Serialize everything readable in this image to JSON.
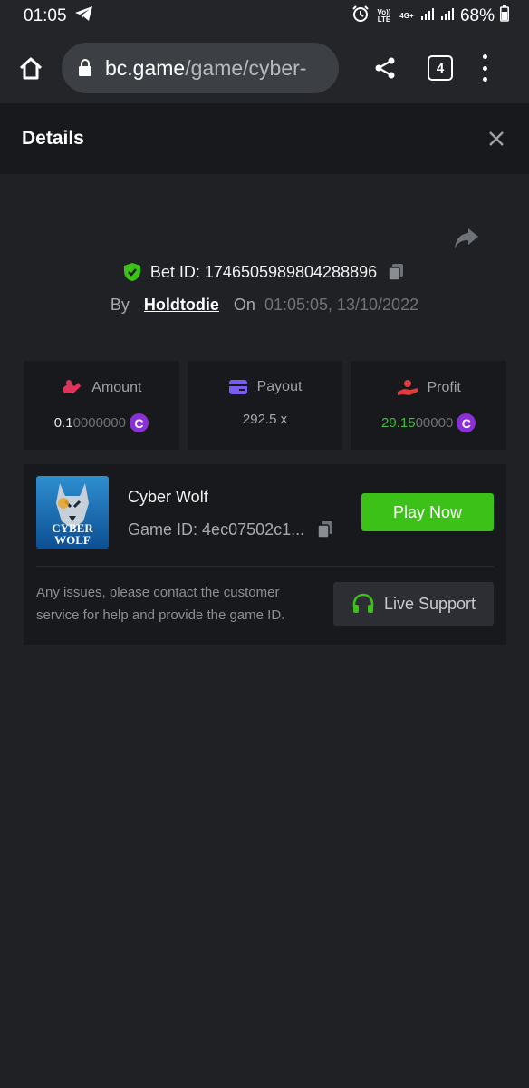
{
  "status_bar": {
    "time": "01:05",
    "volte_label": "Vo)) LTE",
    "network_label": "4G+",
    "battery": "68%"
  },
  "browser": {
    "url_host": "bc.game",
    "url_path": "/game/cyber-",
    "tab_count": "4"
  },
  "details": {
    "title": "Details"
  },
  "bet": {
    "id_label": "Bet ID:",
    "id_value": "1746505989804288896",
    "by_label": "By",
    "user": "Holdtodie",
    "on_label": "On",
    "datetime": "01:05:05, 13/10/2022"
  },
  "stats": {
    "amount": {
      "label": "Amount",
      "value_strong": "0.1",
      "value_faint": "0000000",
      "coin": "C"
    },
    "payout": {
      "label": "Payout",
      "value": "292.5 x"
    },
    "profit": {
      "label": "Profit",
      "value_strong": "29.15",
      "value_faint": "00000",
      "coin": "C"
    }
  },
  "game": {
    "name": "Cyber Wolf",
    "id_label": "Game ID:",
    "id_value": "4ec07502c1...",
    "thumb_title_line1": "CYBER",
    "thumb_title_line2": "WOLF",
    "play_label": "Play Now",
    "issues_text": "Any issues, please contact the customer service for help and provide the game ID.",
    "support_label": "Live Support"
  },
  "colors": {
    "background": "#1f2125",
    "panel": "#18191c",
    "accent_green": "#3bc117",
    "coin_purple": "#8b2fd6",
    "profit_green": "#3fbf3a",
    "amount_icon": "#e0335a",
    "payout_icon": "#7b5cf0",
    "profit_icon": "#e03a3a"
  }
}
